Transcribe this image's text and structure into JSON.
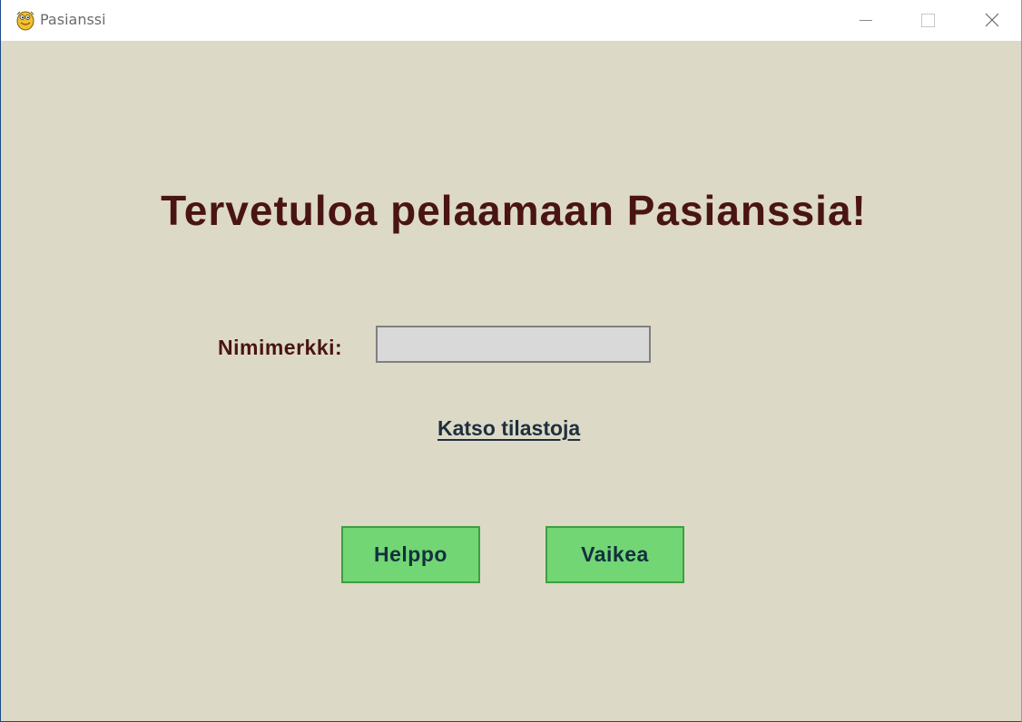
{
  "window": {
    "title": "Pasianssi",
    "app_icon": "python-icon",
    "controls": [
      "minimize-icon",
      "maximize-icon",
      "close-icon"
    ]
  },
  "main": {
    "heading": "Tervetuloa pelaamaan Pasianssia!",
    "nickname_label": "Nimimerkki:",
    "nickname_value": "",
    "stats_link": "Katso tilastoja",
    "buttons": {
      "easy": "Helppo",
      "hard": "Vaikea"
    }
  },
  "colors": {
    "background": "#dcdac6",
    "heading": "#4a1414",
    "button_fill": "#72d674",
    "button_border": "#3e9f40",
    "input_fill": "#d9d9d9",
    "link": "#1f2f3f"
  }
}
